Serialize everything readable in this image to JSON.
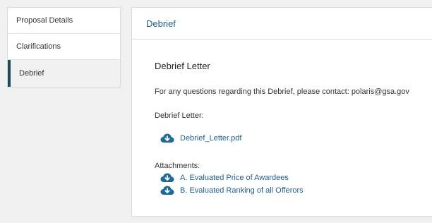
{
  "sidebar": {
    "items": [
      {
        "label": "Proposal Details",
        "active": false
      },
      {
        "label": "Clarifications",
        "active": false
      },
      {
        "label": "Debrief",
        "active": true
      }
    ]
  },
  "panel": {
    "header_title": "Debrief",
    "section_title": "Debrief Letter",
    "contact_line": "For any questions regarding this Debrief, please contact: polaris@gsa.gov",
    "letter_label": "Debrief Letter:",
    "letter_file": {
      "name": "Debrief_Letter.pdf",
      "icon": "cloud-download-icon"
    },
    "attachments_label": "Attachments:",
    "attachments": [
      {
        "name": "A. Evaluated Price of Awardees",
        "icon": "cloud-download-icon"
      },
      {
        "name": "B. Evaluated Ranking of all Offerors",
        "icon": "cloud-download-icon"
      }
    ]
  },
  "colors": {
    "accent": "#1f5f8a",
    "active_bar": "#1d4a5a",
    "icon": "#1f6a96"
  }
}
